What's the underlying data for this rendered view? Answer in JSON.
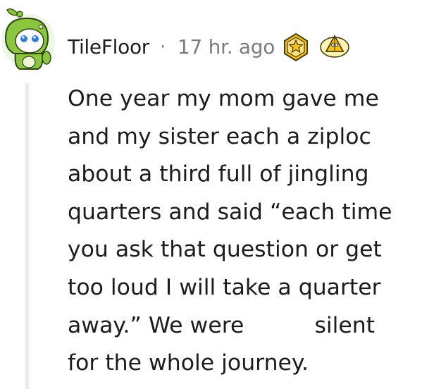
{
  "comment": {
    "author": "TileFloor",
    "separator": "·",
    "timestamp": "17 hr. ago",
    "awards": [
      "gold-star-award-icon",
      "helpful-pyramid-award-icon"
    ],
    "body_lines": [
      "One year my mom gave me",
      "and my sister each a ziploc",
      "about a third full of jingling",
      "quarters and said “each time",
      "you ask that question or get",
      "too loud I will take a quarter",
      "away.” We were          silent",
      "for the whole journey."
    ]
  },
  "colors": {
    "text": "#1c1c1c",
    "meta": "#7c7c7c",
    "thread_line": "#eaeaea",
    "avatar_green": "#8cc63f",
    "award_gold": "#f5c518"
  }
}
